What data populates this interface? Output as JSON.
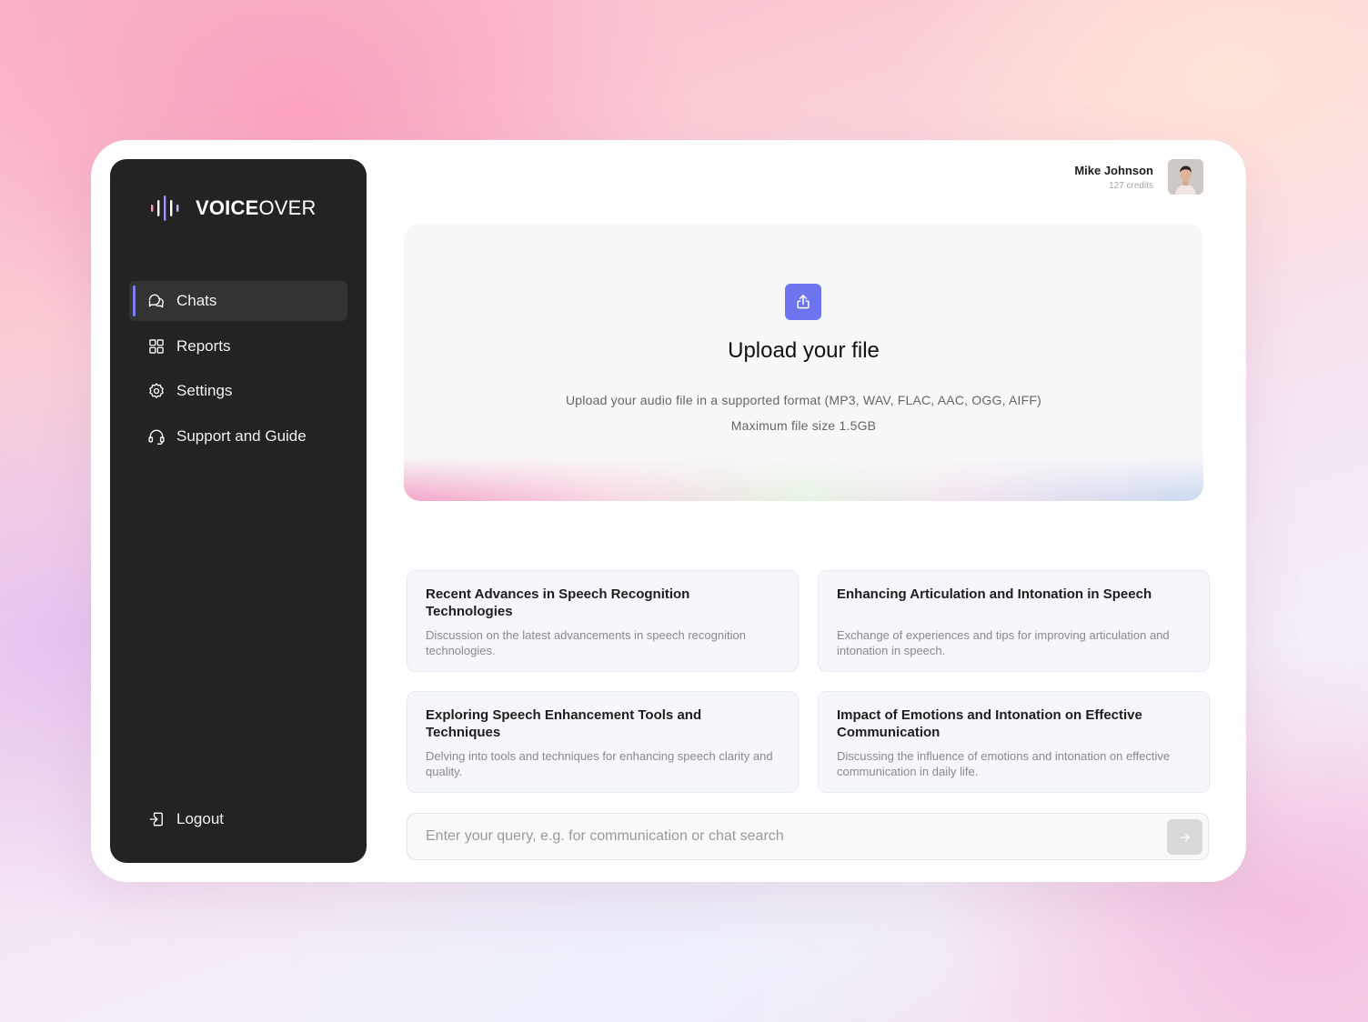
{
  "brand": {
    "name_bold": "VOICE",
    "name_light": "OVER"
  },
  "nav": {
    "items": [
      {
        "label": "Chats",
        "icon": "chat-bubbles-icon",
        "active": true
      },
      {
        "label": "Reports",
        "icon": "grid-icon",
        "active": false
      },
      {
        "label": "Settings",
        "icon": "gear-icon",
        "active": false
      },
      {
        "label": "Support and Guide",
        "icon": "headset-icon",
        "active": false
      }
    ],
    "logout_label": "Logout"
  },
  "user": {
    "name": "Mike Johnson",
    "credits": "127 credits"
  },
  "upload": {
    "title": "Upload your file",
    "description": "Upload your audio file in a supported format (MP3, WAV, FLAC, AAC, OGG, AIFF)",
    "max_size": "Maximum file size 1.5GB",
    "accent_color": "#6c74ee"
  },
  "topics": [
    {
      "title": "Recent Advances in Speech Recognition Technologies",
      "description": "Discussion on the latest advancements in speech recognition technologies."
    },
    {
      "title": "Enhancing Articulation and Intonation in Speech",
      "description": "Exchange of experiences and tips for improving articulation and intonation in speech."
    },
    {
      "title": "Exploring Speech Enhancement Tools and Techniques",
      "description": "Delving into tools and techniques for enhancing speech clarity and quality."
    },
    {
      "title": "Impact of Emotions and Intonation on Effective Communication",
      "description": "Discussing the influence of emotions and intonation on effective communication in daily life."
    }
  ],
  "query": {
    "placeholder": "Enter your query, e.g. for communication or chat search",
    "value": ""
  },
  "colors": {
    "sidebar_bg": "#232323",
    "active_indicator": "#7b7ff0"
  }
}
